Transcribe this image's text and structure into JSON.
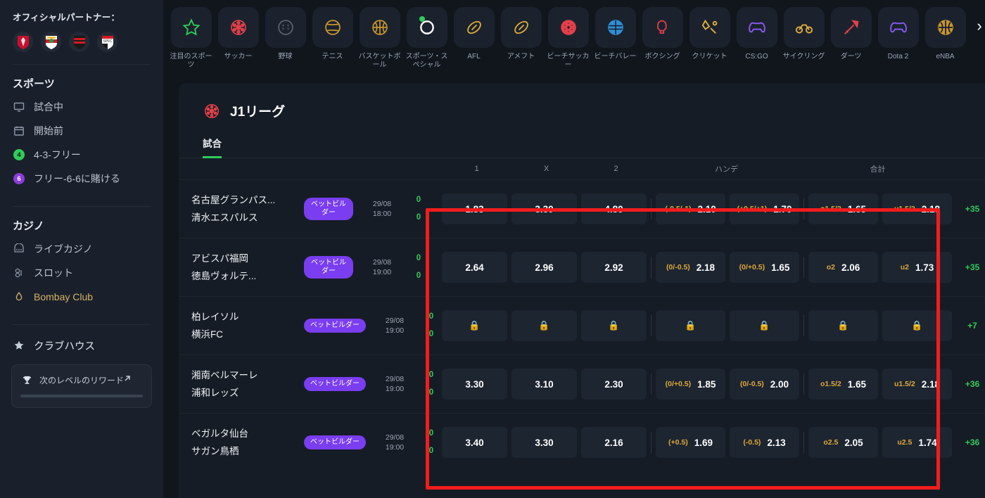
{
  "sidebar": {
    "partner_label": "オフィシャルパートナー：",
    "crests": [
      {
        "name": "arsenal-crest"
      },
      {
        "name": "southampton-crest"
      },
      {
        "name": "flamengo-crest"
      },
      {
        "name": "sao-paulo-crest"
      }
    ],
    "sports_heading": "スポーツ",
    "sports_items": [
      {
        "label": "試合中",
        "icon": "monitor-icon",
        "badge": null
      },
      {
        "label": "開始前",
        "icon": "calendar-icon",
        "badge": null
      },
      {
        "label": "4-3-フリー",
        "icon": "number-badge",
        "badge": "4",
        "badge_color": "green"
      },
      {
        "label": "フリー-6-6に賭ける",
        "icon": "number-badge",
        "badge": "6",
        "badge_color": "purple"
      }
    ],
    "casino_heading": "カジノ",
    "casino_items": [
      {
        "label": "ライブカジノ",
        "icon": "live-casino-icon",
        "gold": false
      },
      {
        "label": "スロット",
        "icon": "slot-icon",
        "gold": false
      },
      {
        "label": "Bombay Club",
        "icon": "bombay-icon",
        "gold": true
      }
    ],
    "clubhouse_label": "クラブハウス",
    "reward_label": "次のレベルのリワード"
  },
  "sportnav": {
    "items": [
      {
        "label": "注目のスポーツ",
        "icon": "star-icon",
        "color": "#2ecc5a",
        "active": false
      },
      {
        "label": "サッカー",
        "icon": "soccer-ball-icon",
        "color": "#e2404a",
        "active": false
      },
      {
        "label": "野球",
        "icon": "baseball-icon",
        "color": "#5b6270",
        "active": false
      },
      {
        "label": "テニス",
        "icon": "tennis-ball-icon",
        "color": "#c9962e",
        "active": false
      },
      {
        "label": "バスケットボール",
        "icon": "basketball-icon",
        "color": "#c9962e",
        "active": false
      },
      {
        "label": "スポーツ・スペシャル",
        "icon": "special-ring-icon",
        "color": "#ffffff",
        "active": true
      },
      {
        "label": "AFL",
        "icon": "afl-ball-icon",
        "color": "#e3b13c",
        "active": false
      },
      {
        "label": "アメフト",
        "icon": "american-football-icon",
        "color": "#e3b13c",
        "active": false
      },
      {
        "label": "ビーチサッカー",
        "icon": "beach-soccer-icon",
        "color": "#e2404a",
        "active": false
      },
      {
        "label": "ビーチバレー",
        "icon": "beach-volley-icon",
        "color": "#2e8fd6",
        "active": false
      },
      {
        "label": "ボクシング",
        "icon": "boxing-glove-icon",
        "color": "#e2404a",
        "active": false
      },
      {
        "label": "クリケット",
        "icon": "cricket-bat-icon",
        "color": "#e3b13c",
        "active": false
      },
      {
        "label": "CS:GO",
        "icon": "gamepad-icon",
        "color": "#8b5cf6",
        "active": false
      },
      {
        "label": "サイクリング",
        "icon": "bicycle-icon",
        "color": "#e3b13c",
        "active": false
      },
      {
        "label": "ダーツ",
        "icon": "dart-icon",
        "color": "#e2404a",
        "active": false
      },
      {
        "label": "Dota 2",
        "icon": "gamepad-icon",
        "color": "#8b5cf6",
        "active": false
      },
      {
        "label": "eNBA",
        "icon": "basketball-icon",
        "color": "#c9962e",
        "active": false
      }
    ],
    "next_arrow": "chevron-right-icon"
  },
  "panel": {
    "title": "J1リーグ",
    "title_icon": "soccer-ball-icon",
    "tab_label": "試合",
    "columns": {
      "one": "1",
      "x": "X",
      "two": "2",
      "handicap": "ハンデ",
      "total": "合計"
    },
    "rows": [
      {
        "home": "名古屋グランパス...",
        "away": "清水エスパルス",
        "badge": "ベットビルダー",
        "date": "29/08",
        "time": "18:00",
        "score_home": "0",
        "score_away": "0",
        "one": "1.83",
        "x": "3.30",
        "two": "4.80",
        "h1_label": "(-0.5/-1)",
        "h1_val": "2.10",
        "h2_label": "(+0.5/+1)",
        "h2_val": "1.70",
        "t1_label": "o1.5/2",
        "t1_val": "1.65",
        "t2_label": "u1.5/2",
        "t2_val": "2.18",
        "more": "+35",
        "locked": false
      },
      {
        "home": "アビスパ福岡",
        "away": "徳島ヴォルテ...",
        "badge": "ベットビルダー",
        "date": "29/08",
        "time": "19:00",
        "score_home": "0",
        "score_away": "0",
        "one": "2.64",
        "x": "2.96",
        "two": "2.92",
        "h1_label": "(0/-0.5)",
        "h1_val": "2.18",
        "h2_label": "(0/+0.5)",
        "h2_val": "1.65",
        "t1_label": "o2",
        "t1_val": "2.06",
        "t2_label": "u2",
        "t2_val": "1.73",
        "more": "+35",
        "locked": false
      },
      {
        "home": "柏レイソル",
        "away": "横浜FC",
        "badge": "ベットビルダー",
        "date": "29/08",
        "time": "19:00",
        "score_home": "0",
        "score_away": "0",
        "one": "",
        "x": "",
        "two": "",
        "h1_label": "",
        "h1_val": "",
        "h2_label": "",
        "h2_val": "",
        "t1_label": "",
        "t1_val": "",
        "t2_label": "",
        "t2_val": "",
        "more": "+7",
        "locked": true
      },
      {
        "home": "湘南ベルマーレ",
        "away": "浦和レッズ",
        "badge": "ベットビルダー",
        "date": "29/08",
        "time": "19:00",
        "score_home": "0",
        "score_away": "0",
        "one": "3.30",
        "x": "3.10",
        "two": "2.30",
        "h1_label": "(0/+0.5)",
        "h1_val": "1.85",
        "h2_label": "(0/-0.5)",
        "h2_val": "2.00",
        "t1_label": "o1.5/2",
        "t1_val": "1.65",
        "t2_label": "u1.5/2",
        "t2_val": "2.18",
        "more": "+36",
        "locked": false
      },
      {
        "home": "ベガルタ仙台",
        "away": "サガン鳥栖",
        "badge": "ベットビルダー",
        "date": "29/08",
        "time": "19:00",
        "score_home": "0",
        "score_away": "0",
        "one": "3.40",
        "x": "3.30",
        "two": "2.16",
        "h1_label": "(+0.5)",
        "h1_val": "1.69",
        "h2_label": "(-0.5)",
        "h2_val": "2.13",
        "t1_label": "o2.5",
        "t1_val": "2.05",
        "t2_label": "u2.5",
        "t2_val": "1.74",
        "more": "+36",
        "locked": false
      }
    ]
  },
  "annotation": {
    "highlight_color": "#f01d1d"
  }
}
